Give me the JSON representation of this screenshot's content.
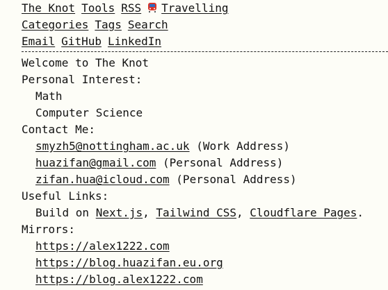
{
  "nav": {
    "row1": {
      "home": "The Knot",
      "tools": "Tools",
      "rss": "RSS",
      "travelling": "Travelling",
      "travelling_icon": "train-icon"
    },
    "row2": {
      "categories": "Categories",
      "tags": "Tags",
      "search": "Search"
    },
    "row3": {
      "email": "Email",
      "github": "GitHub",
      "linkedin": "LinkedIn"
    }
  },
  "content": {
    "welcome": "Welcome to The Knot",
    "interest_heading": "Personal Interest:",
    "interests": [
      "Math",
      "Computer Science"
    ],
    "contact_heading": "Contact Me:",
    "contacts": [
      {
        "email": "smyzh5@nottingham.ac.uk",
        "note": "(Work Address)"
      },
      {
        "email": "huazifan@gmail.com",
        "note": "(Personal Address)"
      },
      {
        "email": "zifan.hua@icloud.com",
        "note": "(Personal Address)"
      }
    ],
    "links_heading": "Useful Links:",
    "build": {
      "prefix": "Build on",
      "tool1": "Next.js",
      "sep1": ",",
      "tool2": "Tailwind CSS",
      "sep2": ",",
      "tool3": "Cloudflare Pages",
      "end": "."
    },
    "mirrors_heading": "Mirrors:",
    "mirrors": [
      "https://alex1222.com",
      "https://blog.huazifan.eu.org",
      "https://blog.alex1222.com"
    ]
  },
  "colors": {
    "background": "#fdfdf7",
    "text": "#111111",
    "train_red": "#d9342b",
    "train_blue": "#2b6cc4"
  }
}
